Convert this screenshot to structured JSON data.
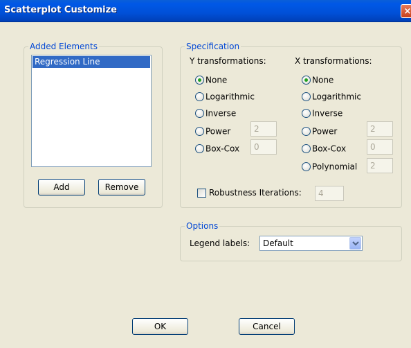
{
  "window": {
    "title": "Scatterplot Customize",
    "close_glyph": "×"
  },
  "added_elements": {
    "legend": "Added Elements",
    "items": [
      "Regression Line"
    ],
    "add_label": "Add",
    "remove_label": "Remove"
  },
  "specification": {
    "legend": "Specification",
    "y": {
      "heading": "Y transformations:",
      "options": [
        "None",
        "Logarithmic",
        "Inverse",
        "Power",
        "Box-Cox"
      ],
      "selected": "None",
      "power_value": "2",
      "boxcox_value": "0"
    },
    "x": {
      "heading": "X transformations:",
      "options": [
        "None",
        "Logarithmic",
        "Inverse",
        "Power",
        "Box-Cox",
        "Polynomial"
      ],
      "selected": "None",
      "power_value": "2",
      "boxcox_value": "0",
      "polynomial_value": "2"
    },
    "robustness": {
      "label": "Robustness Iterations:",
      "checked": false,
      "value": "4"
    }
  },
  "options": {
    "legend": "Options",
    "legend_labels_label": "Legend labels:",
    "legend_labels_value": "Default"
  },
  "footer": {
    "ok_label": "OK",
    "cancel_label": "Cancel"
  },
  "colors": {
    "title_bar": "#0054e3",
    "group_legend": "#0046d5",
    "selection": "#316ac5",
    "radio_dot": "#21a121"
  }
}
